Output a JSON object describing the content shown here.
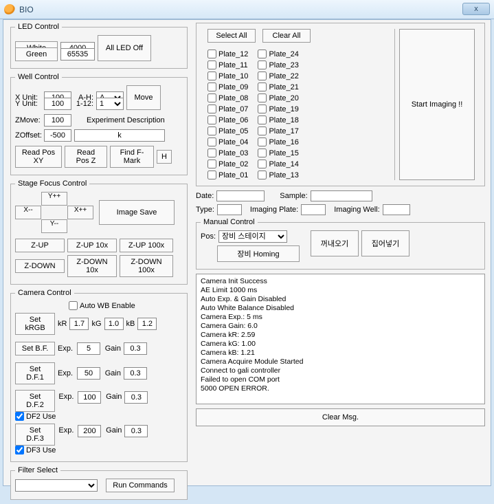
{
  "titlebar": {
    "title": "BIO",
    "close": "x"
  },
  "led": {
    "legend": "LED Control",
    "white_label": "White",
    "white_val": "4000",
    "green_label": "Green",
    "green_val": "65535",
    "all_off": "All LED Off"
  },
  "well": {
    "legend": "Well Control",
    "xunit_lbl": "X Unit:",
    "xunit_val": "100",
    "yunit_lbl": "Y Unit:",
    "yunit_val": "100",
    "ah_lbl": "A-H:",
    "ah_val": "A",
    "n112_lbl": "1-12:",
    "n112_val": "1",
    "move": "Move",
    "zmove_lbl": "ZMove:",
    "zmove_val": "100",
    "exp_desc_lbl": "Experiment  Description",
    "zoff_lbl": "ZOffset:",
    "zoff_val": "-500",
    "zoff_desc": "k",
    "readxy": "Read Pos XY",
    "readz": "Read Pos Z",
    "fmark": "Find F-Mark",
    "h": "H"
  },
  "stage": {
    "legend": "Stage  Focus Control",
    "yplus": "Y++",
    "yminus": "Y--",
    "xminus": "X--",
    "xplus": "X++",
    "imgsave": "Image Save",
    "zup": "Z-UP",
    "zup10": "Z-UP 10x",
    "zup100": "Z-UP 100x",
    "zdn": "Z-DOWN",
    "zdn10": "Z-DOWN 10x",
    "zdn100": "Z-DOWN 100x"
  },
  "camera": {
    "legend": "Camera Control",
    "autowb": "Auto WB Enable",
    "setkrgb": "Set kRGB",
    "kr_lbl": "kR",
    "kr_val": "1.7",
    "kg_lbl": "kG",
    "kg_val": "1.0",
    "kb_lbl": "kB",
    "kb_val": "1.2",
    "setbf": "Set B.F.",
    "setdf1": "Set D.F.1",
    "setdf2": "Set D.F.2",
    "setdf3": "Set D.F.3",
    "df2use": "DF2 Use",
    "df3use": "DF3 Use",
    "exp_lbl": "Exp.",
    "gain_lbl": "Gain",
    "bf_exp": "5",
    "bf_gain": "0.3",
    "df1_exp": "50",
    "df1_gain": "0.3",
    "df2_exp": "100",
    "df2_gain": "0.3",
    "df3_exp": "200",
    "df3_gain": "0.3"
  },
  "filter": {
    "legend": "Filter Select",
    "run": "Run Commands"
  },
  "topbtns": {
    "selectall": "Select All",
    "clearall": "Clear All"
  },
  "plates": {
    "col1": [
      "Plate_12",
      "Plate_11",
      "Plate_10",
      "Plate_09",
      "Plate_08",
      "Plate_07",
      "Plate_06",
      "Plate_05",
      "Plate_04",
      "Plate_03",
      "Plate_02",
      "Plate_01"
    ],
    "col2": [
      "Plate_24",
      "Plate_23",
      "Plate_22",
      "Plate_21",
      "Plate_20",
      "Plate_19",
      "Plate_18",
      "Plate_17",
      "Plate_16",
      "Plate_15",
      "Plate_14",
      "Plate_13"
    ]
  },
  "start": "Start Imaging !!",
  "info": {
    "date_lbl": "Date:",
    "sample_lbl": "Sample:",
    "type_lbl": "Type:",
    "imgplate_lbl": "Imaging Plate:",
    "imgwell_lbl": "Imaging Well:"
  },
  "manual": {
    "legend": "Manual Control",
    "pos_lbl": "Pos:",
    "pos_val": "장비 스테이지",
    "out": "꺼내오기",
    "in": "집어넣기",
    "homing": "장비 Homing"
  },
  "log": "Camera Init Success\nAE Limit 1000 ms\nAuto Exp. & Gain Disabled\nAuto White Balance Disabled\nCamera Exp.: 5 ms\nCamera Gain: 6.0\nCamera kR: 2.59\nCamera kG: 1.00\nCamera kB: 1.21\nCamera Acquire Module Started\nConnect to gali controller\nFailed to open COM port\n5000 OPEN ERROR.",
  "clearmsg": "Clear Msg."
}
